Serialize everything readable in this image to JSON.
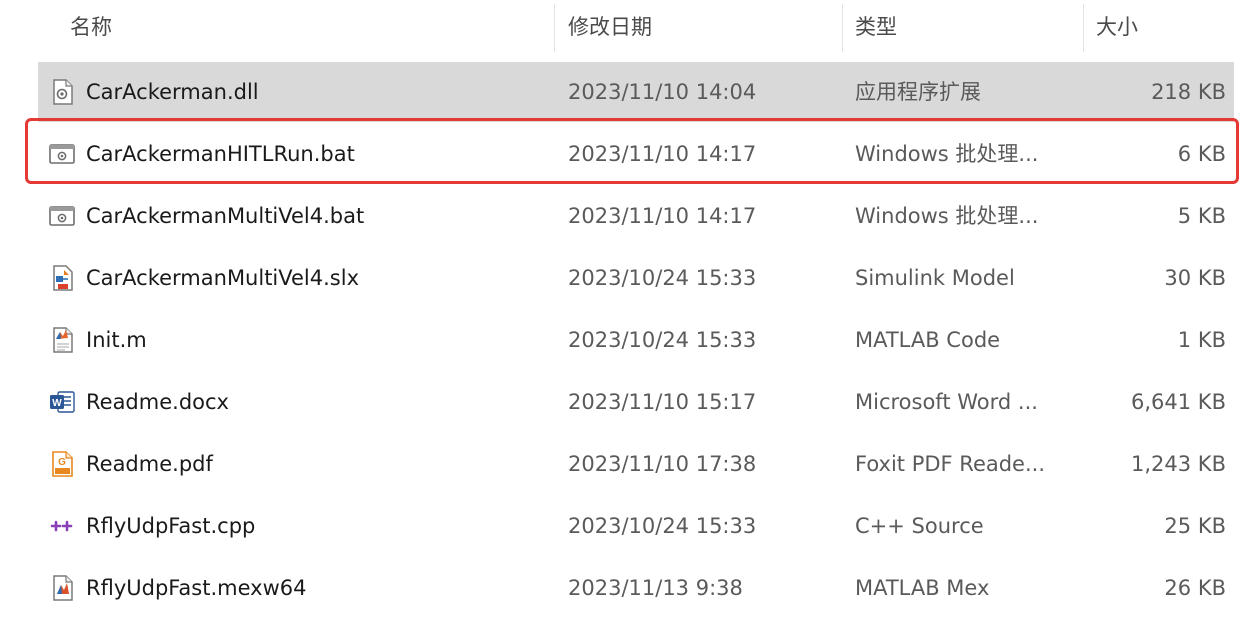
{
  "columns": {
    "name": "名称",
    "modified": "修改日期",
    "type": "类型",
    "size": "大小"
  },
  "files": [
    {
      "name": "CarAckerman.dll",
      "modified": "2023/11/10 14:04",
      "type": "应用程序扩展",
      "size": "218 KB",
      "icon": "dll-file-icon",
      "selected": true
    },
    {
      "name": "CarAckermanHITLRun.bat",
      "modified": "2023/11/10 14:17",
      "type": "Windows 批处理...",
      "size": "6 KB",
      "icon": "batch-file-icon",
      "highlighted": true
    },
    {
      "name": "CarAckermanMultiVel4.bat",
      "modified": "2023/11/10 14:17",
      "type": "Windows 批处理...",
      "size": "5 KB",
      "icon": "batch-file-icon"
    },
    {
      "name": "CarAckermanMultiVel4.slx",
      "modified": "2023/10/24 15:33",
      "type": "Simulink Model",
      "size": "30 KB",
      "icon": "simulink-model-icon"
    },
    {
      "name": "Init.m",
      "modified": "2023/10/24 15:33",
      "type": "MATLAB Code",
      "size": "1 KB",
      "icon": "matlab-code-icon"
    },
    {
      "name": "Readme.docx",
      "modified": "2023/11/10 15:17",
      "type": "Microsoft Word ...",
      "size": "6,641 KB",
      "icon": "word-document-icon"
    },
    {
      "name": "Readme.pdf",
      "modified": "2023/11/10 17:38",
      "type": "Foxit PDF Reade...",
      "size": "1,243 KB",
      "icon": "pdf-file-icon"
    },
    {
      "name": "RflyUdpFast.cpp",
      "modified": "2023/10/24 15:33",
      "type": "C++ Source",
      "size": "25 KB",
      "icon": "cpp-source-icon"
    },
    {
      "name": "RflyUdpFast.mexw64",
      "modified": "2023/11/13 9:38",
      "type": "MATLAB Mex",
      "size": "26 KB",
      "icon": "matlab-mex-icon"
    }
  ],
  "colors": {
    "selected_row": "#d9d9d9",
    "highlight_border": "#e53935"
  }
}
